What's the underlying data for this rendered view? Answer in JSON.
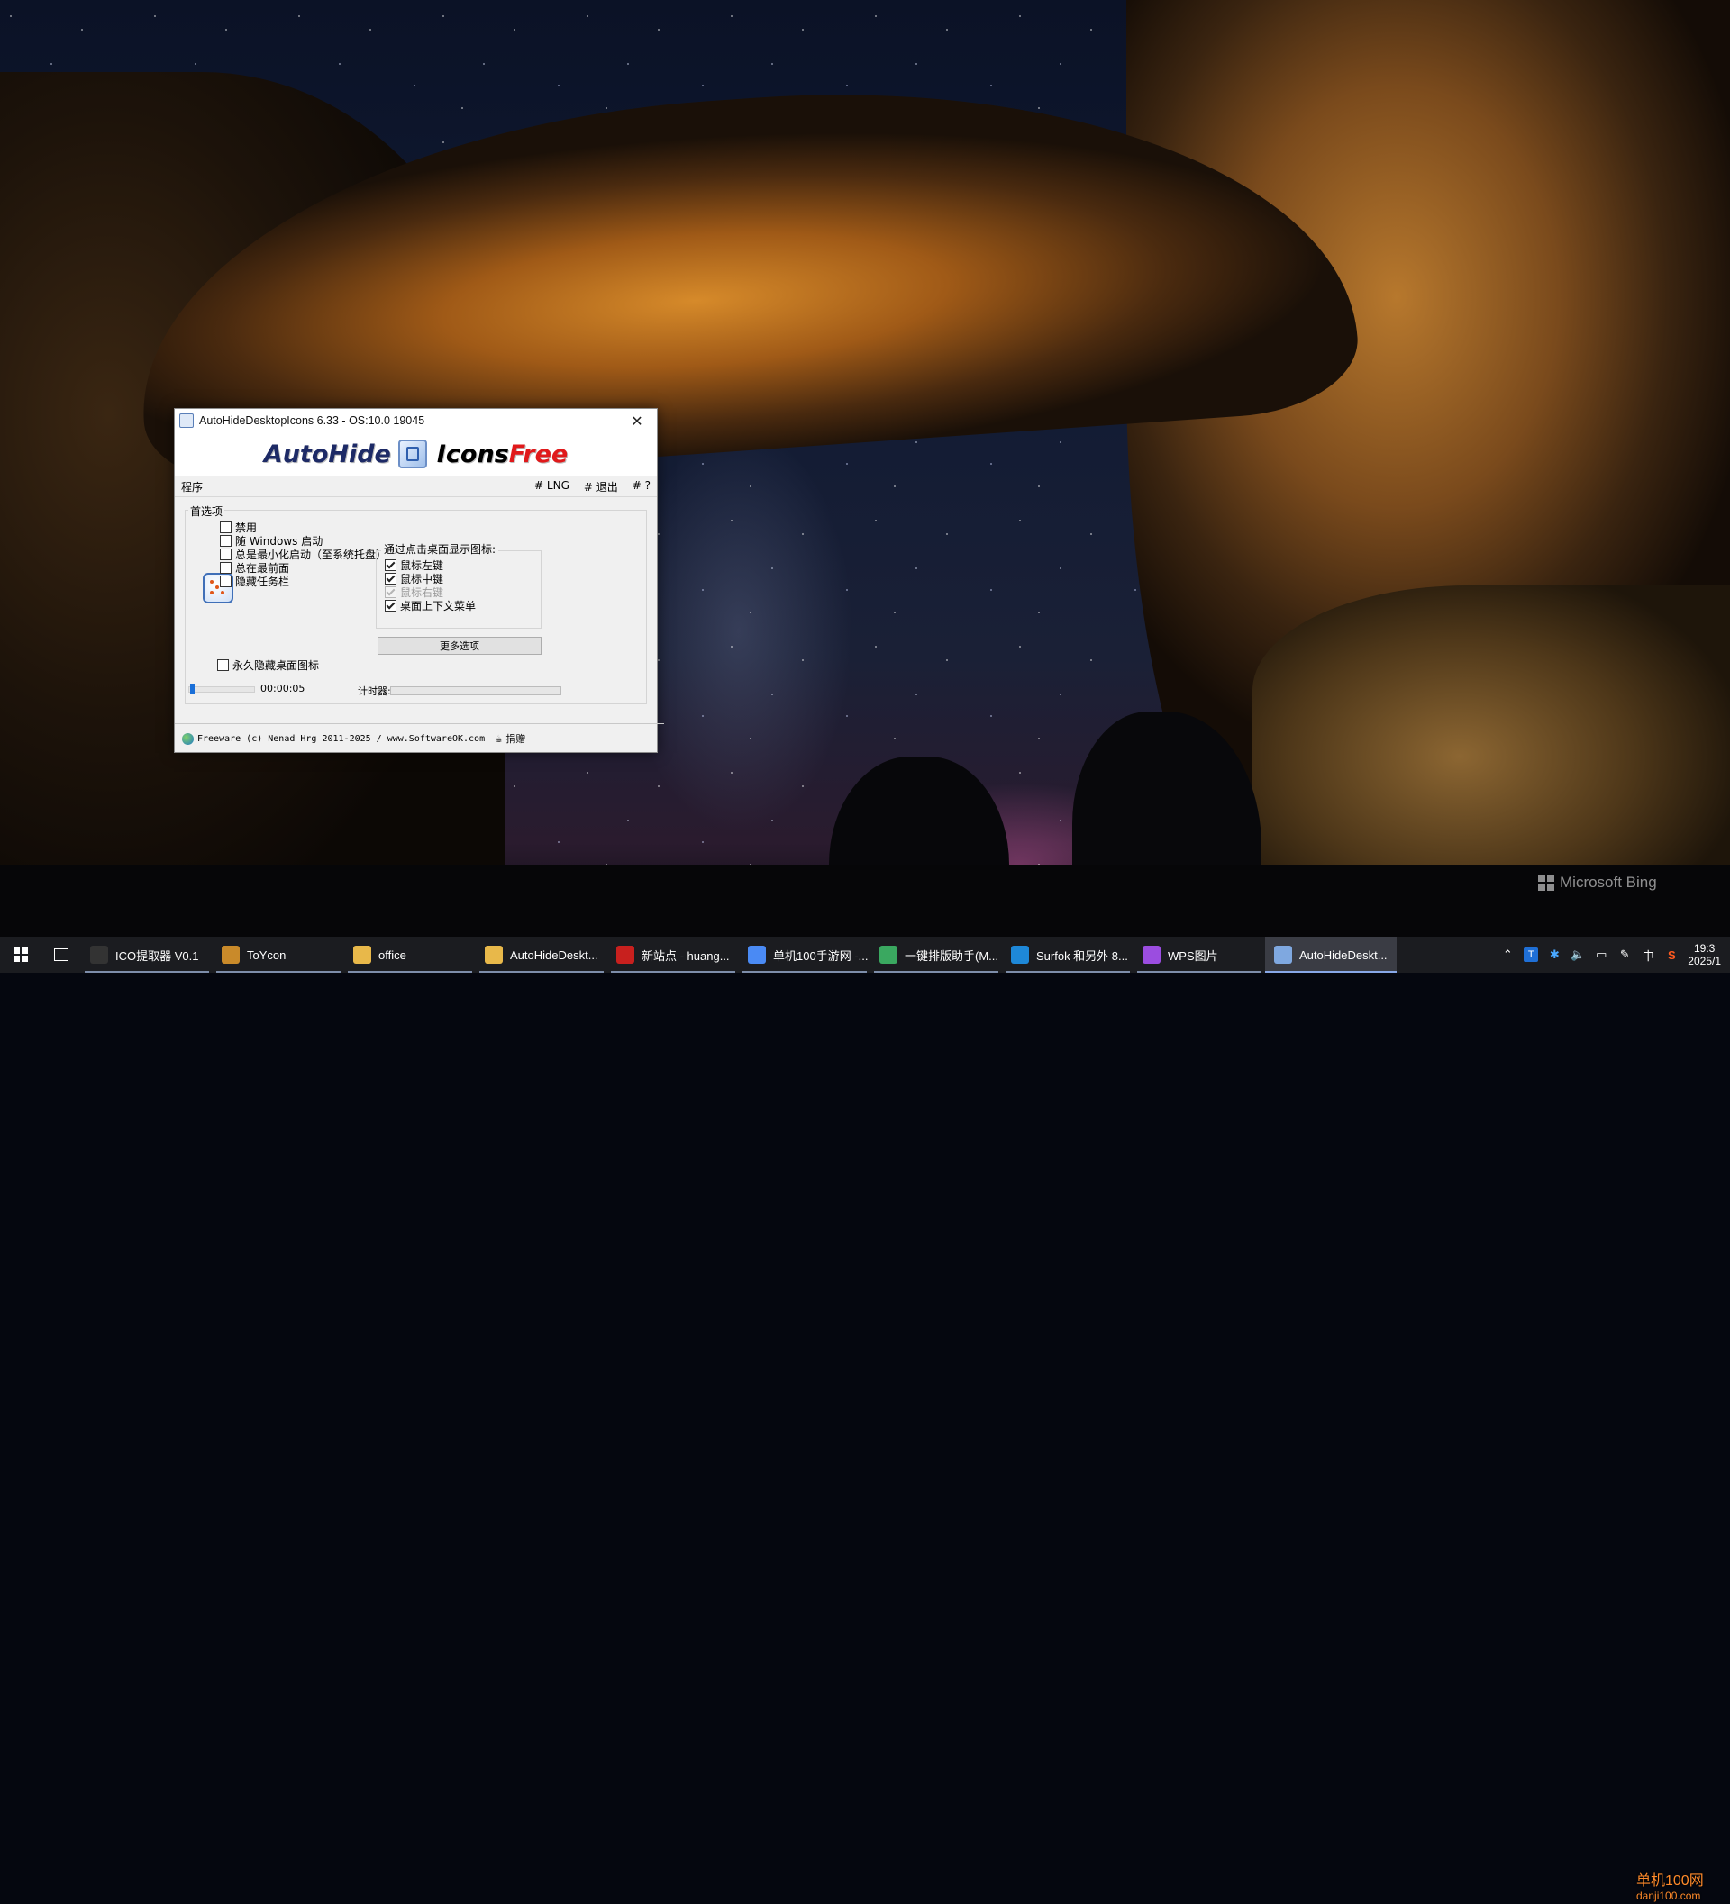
{
  "wallpaper": {
    "watermark_text": "Microsoft Bing"
  },
  "window": {
    "title": "AutoHideDesktopIcons 6.33 - OS:10.0 19045",
    "close_glyph": "✕",
    "banner": {
      "part1": "AutoHide",
      "part2": "Icons",
      "part3": "Free"
    },
    "menu": {
      "program": "程序",
      "lng": "# LNG",
      "exit": "# 退出",
      "help": "# ?"
    },
    "prefs": {
      "group_label": "首选项",
      "options": [
        {
          "label": "禁用",
          "checked": false
        },
        {
          "label": "随 Windows 启动",
          "checked": false
        },
        {
          "label": "总是最小化启动（至系统托盘）",
          "checked": false
        },
        {
          "label": "总在最前面",
          "checked": false
        },
        {
          "label": "隐藏任务栏",
          "checked": false
        }
      ],
      "permanent_hide": {
        "label": "永久隐藏桌面图标",
        "checked": false
      }
    },
    "click_show": {
      "title": "通过点击桌面显示图标:",
      "options": [
        {
          "label": "鼠标左键",
          "checked": true,
          "disabled": false
        },
        {
          "label": "鼠标中键",
          "checked": true,
          "disabled": false
        },
        {
          "label": "鼠标右键",
          "checked": true,
          "disabled": true
        },
        {
          "label": "桌面上下文菜单",
          "checked": true,
          "disabled": false
        }
      ]
    },
    "more_button": "更多选项",
    "timer": {
      "value": "00:00:05",
      "label": "计时器:",
      "slider_fraction": 0.02,
      "progress_fraction": 0
    },
    "footer": {
      "text": "Freeware (c) Nenad Hrg 2011-2025 / www.SoftwareOK.com",
      "donate": "捐赠"
    }
  },
  "taskbar": {
    "items": [
      {
        "label": "ICO提取器 V0.1",
        "icon": "ico-extractor-icon",
        "color": "#333333",
        "active": false
      },
      {
        "label": "ToYcon",
        "icon": "toycon-icon",
        "color": "#c98a2a",
        "active": false
      },
      {
        "label": "office",
        "icon": "folder-icon",
        "color": "#e8b84a",
        "active": false
      },
      {
        "label": "AutoHideDeskt...",
        "icon": "folder-icon",
        "color": "#e8b84a",
        "active": false
      },
      {
        "label": "新站点 - huang...",
        "icon": "filezilla-icon",
        "color": "#c8201e",
        "active": false
      },
      {
        "label": "单机100手游网 -...",
        "icon": "chrome-icon",
        "color": "#4a8af4",
        "active": false
      },
      {
        "label": "一键排版助手(M...",
        "icon": "typeset-icon",
        "color": "#3aa860",
        "active": false
      },
      {
        "label": "Surfok 和另外 8...",
        "icon": "edge-icon",
        "color": "#1e88d8",
        "active": false
      },
      {
        "label": "WPS图片",
        "icon": "wps-picture-icon",
        "color": "#9b4de0",
        "active": false
      },
      {
        "label": "AutoHideDeskt...",
        "icon": "autohide-icon",
        "color": "#7fa8e0",
        "active": true
      }
    ],
    "tray": {
      "ime": "中",
      "clock_time": "19:3",
      "clock_date": "2025/1"
    },
    "corner_watermark": {
      "line1": "单机100网",
      "line2": "danji100.com"
    }
  }
}
